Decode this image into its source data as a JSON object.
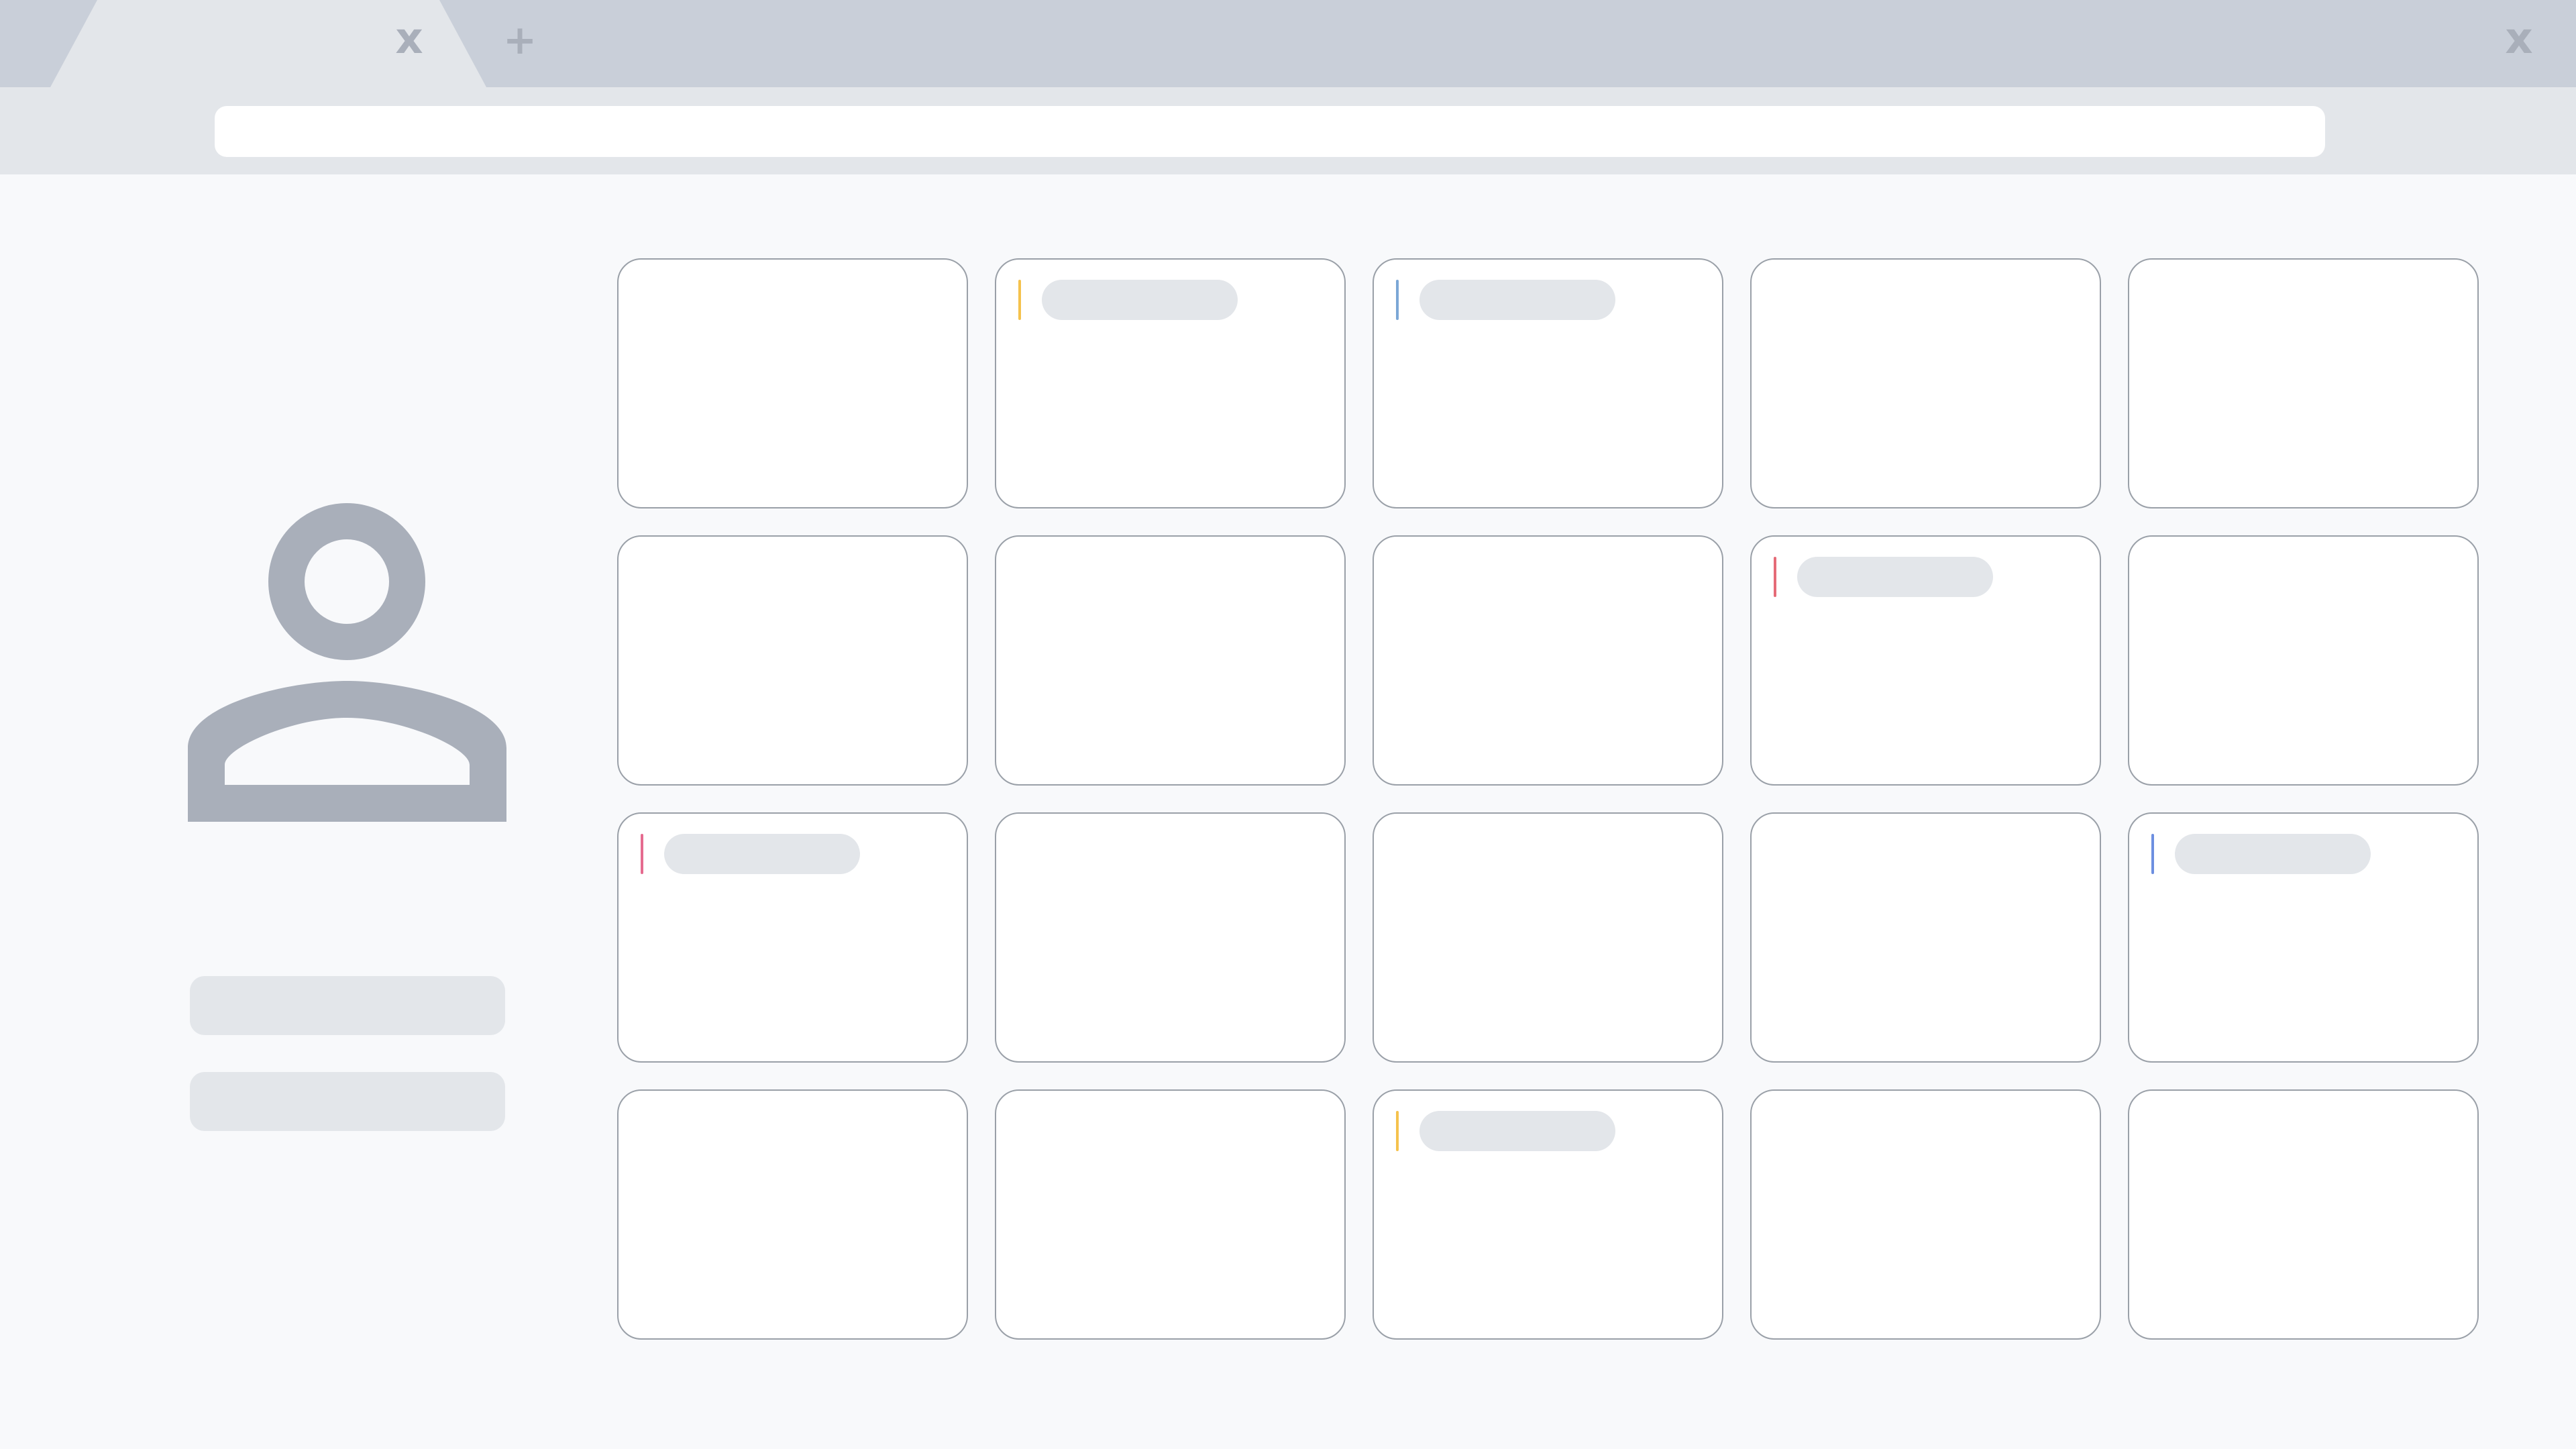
{
  "tabs": {
    "active_close_glyph": "x",
    "new_tab_glyph": "+",
    "window_close_glyph": "x"
  },
  "address_bar": {
    "value": "",
    "placeholder": ""
  },
  "colors": {
    "tabstrip": "#c9cfd9",
    "active_tab": "#e3e6ea",
    "content_bg": "#f8f9fb",
    "placeholder": "#e3e6ea",
    "icon": "#a9afba",
    "event_yellow": "#f5c24d",
    "event_blue": "#7ba7d6",
    "event_red": "#e56b77",
    "event_pink": "#e56b8f",
    "event_blue2": "#6d8fe0"
  },
  "sidebar": {
    "icon": "user-profile-icon"
  },
  "calendar": {
    "rows": 4,
    "columns": 5,
    "events": [
      {
        "row": 0,
        "col": 1,
        "color": "#f5c24d"
      },
      {
        "row": 0,
        "col": 2,
        "color": "#7ba7d6"
      },
      {
        "row": 1,
        "col": 3,
        "color": "#e56b77"
      },
      {
        "row": 2,
        "col": 0,
        "color": "#e56b8f"
      },
      {
        "row": 2,
        "col": 4,
        "color": "#6d8fe0"
      },
      {
        "row": 3,
        "col": 2,
        "color": "#f5c24d"
      }
    ]
  }
}
